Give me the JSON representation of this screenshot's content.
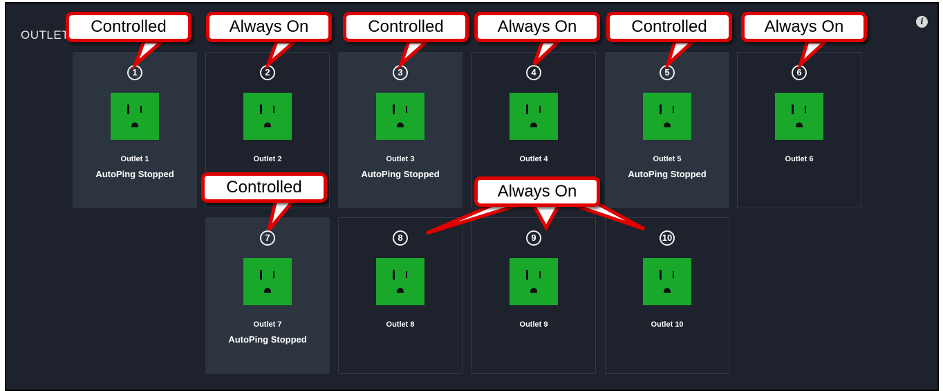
{
  "panel": {
    "title": "OUTLETS"
  },
  "outlets": [
    {
      "number": "1",
      "name": "Outlet 1",
      "status": "AutoPing Stopped"
    },
    {
      "number": "2",
      "name": "Outlet 2",
      "status": ""
    },
    {
      "number": "3",
      "name": "Outlet 3",
      "status": "AutoPing Stopped"
    },
    {
      "number": "4",
      "name": "Outlet 4",
      "status": ""
    },
    {
      "number": "5",
      "name": "Outlet 5",
      "status": "AutoPing Stopped"
    },
    {
      "number": "6",
      "name": "Outlet 6",
      "status": ""
    },
    {
      "number": "7",
      "name": "Outlet 7",
      "status": "AutoPing Stopped"
    },
    {
      "number": "8",
      "name": "Outlet 8",
      "status": ""
    },
    {
      "number": "9",
      "name": "Outlet 9",
      "status": ""
    },
    {
      "number": "10",
      "name": "Outlet 10",
      "status": ""
    }
  ],
  "callouts": [
    "Controlled",
    "Always On",
    "Controlled",
    "Always On",
    "Controlled",
    "Always On",
    "Controlled",
    "Always On"
  ],
  "colors": {
    "panel_bg": "#1d222c",
    "controlled_card_bg": "#2c3440",
    "outlet_green": "#19a82a",
    "callout_border": "#e00000"
  },
  "icons": {
    "info": "info-icon",
    "outlet": "outlet-icon"
  }
}
